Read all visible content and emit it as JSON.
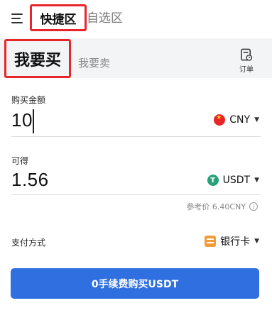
{
  "header": {
    "menu_icon": "menu-icon",
    "tabs": [
      {
        "label": "快捷区",
        "active": true
      },
      {
        "label": "自选区",
        "active": false
      }
    ]
  },
  "trade": {
    "buy_label": "我要买",
    "sell_label": "我要卖",
    "orders_label": "订单",
    "orders_icon": "orders-icon"
  },
  "pay": {
    "label": "购买金额",
    "value": "10",
    "currency": "CNY",
    "currency_icon": "china-flag-icon"
  },
  "receive": {
    "label": "可得",
    "value": "1.56",
    "currency": "USDT",
    "currency_icon": "tether-icon"
  },
  "reference": {
    "text": "参考价 6.40CNY"
  },
  "payment": {
    "label": "支付方式",
    "method": "银行卡",
    "method_icon": "bank-card-icon"
  },
  "submit": {
    "label": "0手续费购买USDT"
  },
  "colors": {
    "accent": "#2f6fe0",
    "highlight_box": "#e8262a",
    "tether": "#26a17b"
  }
}
